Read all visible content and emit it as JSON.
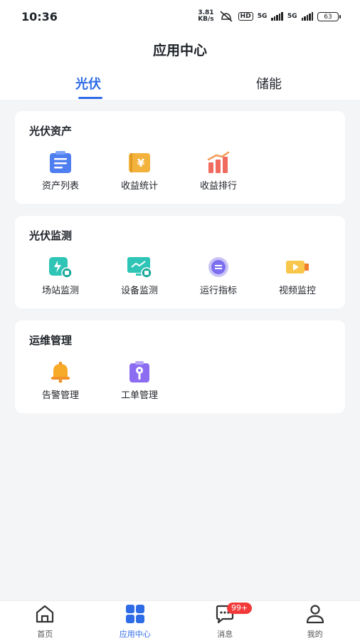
{
  "status_bar": {
    "time": "10:36",
    "net_speed_value": "3.81",
    "net_speed_unit": "KB/s",
    "hd_label": "HD",
    "sig1_label": "5G",
    "sig2_label": "5G",
    "battery": "63"
  },
  "header": {
    "title": "应用中心",
    "tabs": [
      {
        "label": "光伏",
        "active": true
      },
      {
        "label": "储能",
        "active": false
      }
    ]
  },
  "sections": [
    {
      "title": "光伏资产",
      "items": [
        {
          "label": "资产列表",
          "icon": "clipboard-list-icon"
        },
        {
          "label": "收益统计",
          "icon": "yuan-ledger-icon"
        },
        {
          "label": "收益排行",
          "icon": "bar-chart-up-icon"
        }
      ]
    },
    {
      "title": "光伏监测",
      "items": [
        {
          "label": "场站监测",
          "icon": "station-monitor-icon"
        },
        {
          "label": "设备监测",
          "icon": "device-monitor-icon"
        },
        {
          "label": "运行指标",
          "icon": "operation-metric-icon"
        },
        {
          "label": "视频监控",
          "icon": "video-camera-icon"
        }
      ]
    },
    {
      "title": "运维管理",
      "items": [
        {
          "label": "告警管理",
          "icon": "alarm-bell-icon"
        },
        {
          "label": "工单管理",
          "icon": "work-order-icon"
        }
      ]
    }
  ],
  "bottom_nav": {
    "items": [
      {
        "label": "首页",
        "icon": "home-icon"
      },
      {
        "label": "应用中心",
        "icon": "app-grid-icon",
        "active": true
      },
      {
        "label": "消息",
        "icon": "message-icon",
        "badge": "99+"
      },
      {
        "label": "我的",
        "icon": "profile-icon"
      }
    ]
  },
  "colors": {
    "accent": "#2e6be6",
    "badge": "#f2393a",
    "background": "#f4f5f7"
  }
}
